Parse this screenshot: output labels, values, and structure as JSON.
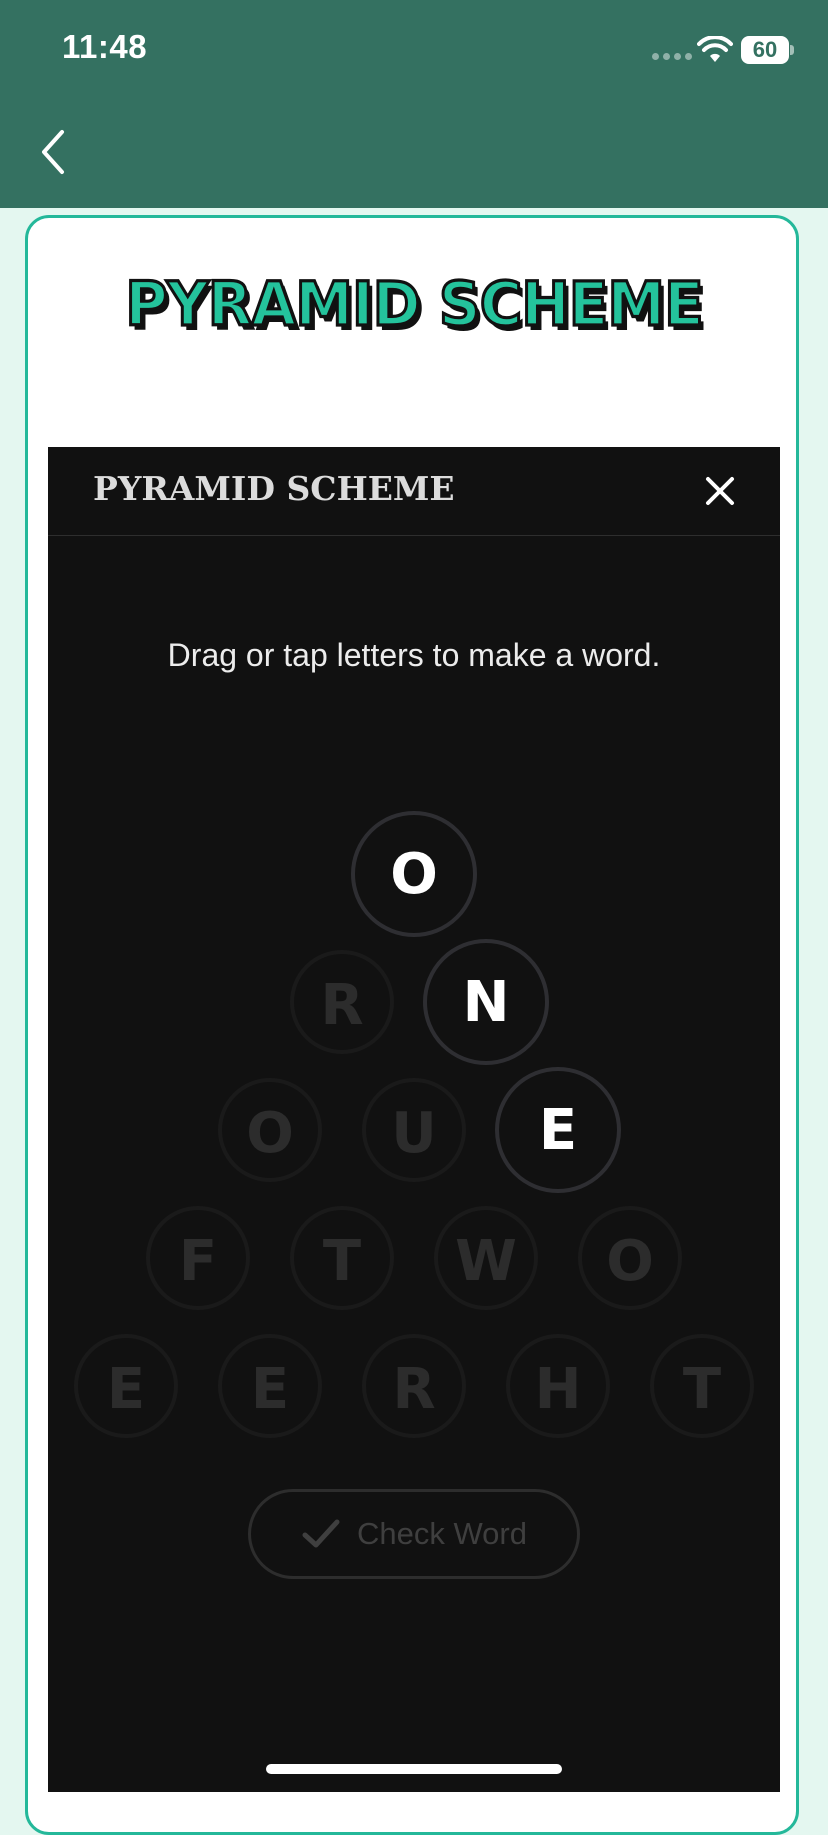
{
  "status_bar": {
    "time": "11:48",
    "battery": "60"
  },
  "nav": {
    "back_icon": "chevron-left-icon"
  },
  "logo": {
    "text": "PYRAMID SCHEME",
    "fill_color": "#24c39c"
  },
  "modal": {
    "title": "PYRAMID SCHEME",
    "close_icon": "close-icon",
    "instruction": "Drag or tap letters to make a word.",
    "rows": [
      [
        {
          "letter": "O",
          "selected": true
        }
      ],
      [
        {
          "letter": "R",
          "selected": false
        },
        {
          "letter": "N",
          "selected": true
        }
      ],
      [
        {
          "letter": "O",
          "selected": false
        },
        {
          "letter": "U",
          "selected": false
        },
        {
          "letter": "E",
          "selected": true
        }
      ],
      [
        {
          "letter": "F",
          "selected": false
        },
        {
          "letter": "T",
          "selected": false
        },
        {
          "letter": "W",
          "selected": false
        },
        {
          "letter": "O",
          "selected": false
        }
      ],
      [
        {
          "letter": "E",
          "selected": false
        },
        {
          "letter": "E",
          "selected": false
        },
        {
          "letter": "R",
          "selected": false
        },
        {
          "letter": "H",
          "selected": false
        },
        {
          "letter": "T",
          "selected": false
        }
      ]
    ],
    "check_button": {
      "label": "Check Word",
      "icon": "checkmark-icon"
    }
  },
  "colors": {
    "header_bg": "#347161",
    "page_bg": "#e4f7f0",
    "accent": "#24b89a",
    "modal_bg": "#111111"
  }
}
